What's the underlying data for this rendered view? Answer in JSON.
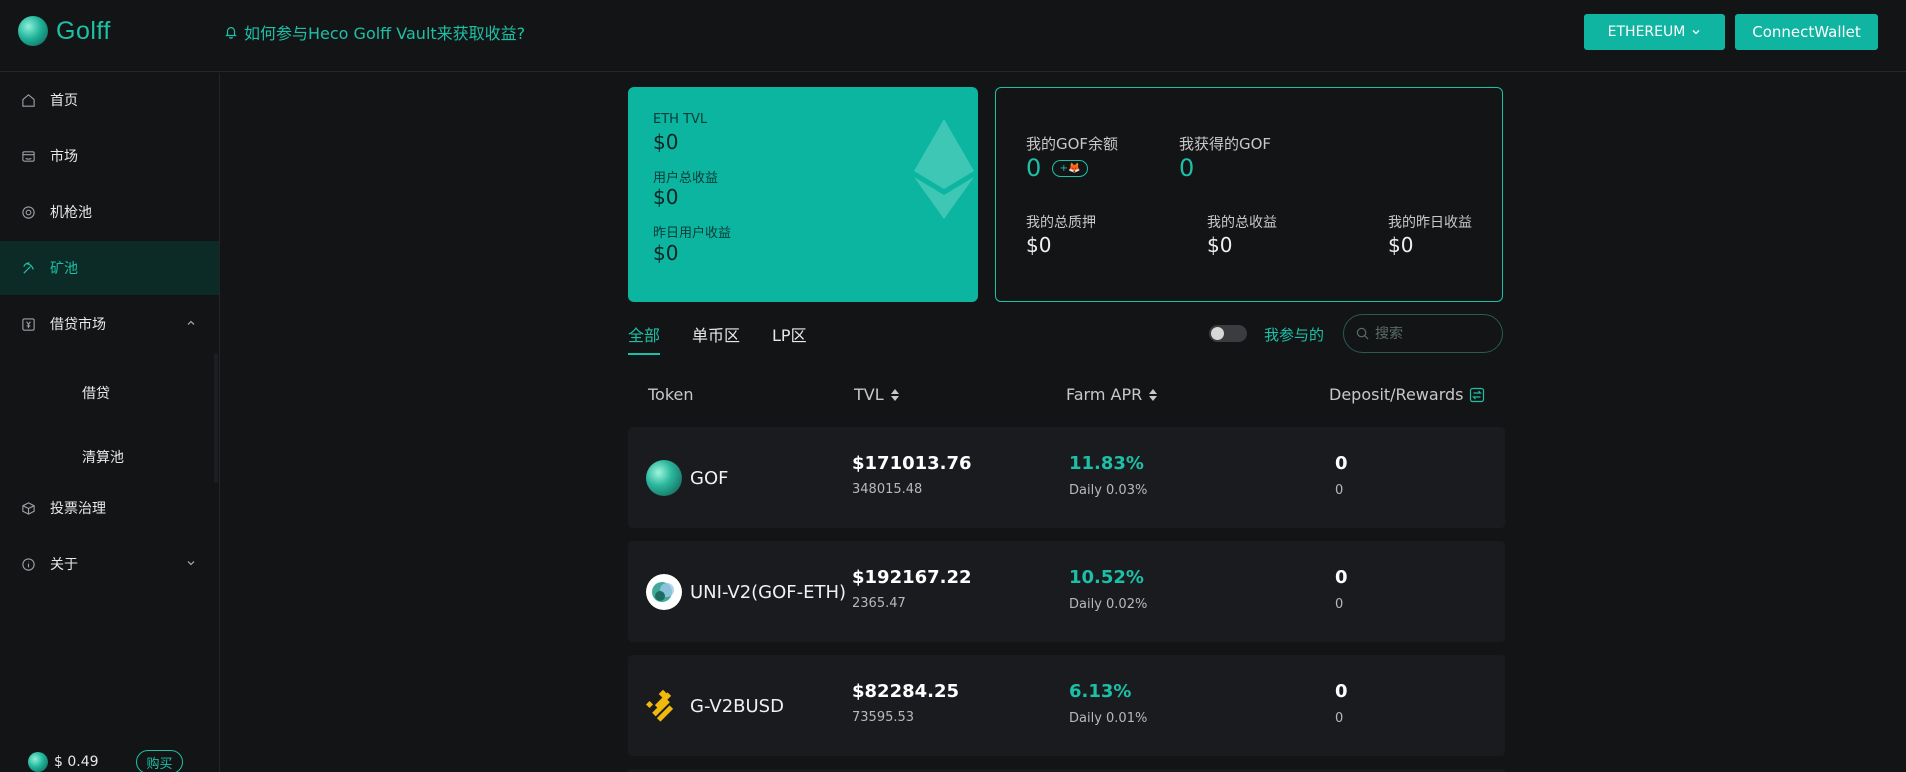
{
  "header": {
    "logo_text": "Golff",
    "announcement": "如何参与Heco Golff Vault来获取收益?",
    "network_button": "ETHEREUM",
    "connect_button": "ConnectWallet"
  },
  "sidebar": {
    "items": [
      {
        "label": "首页",
        "icon": "home-icon"
      },
      {
        "label": "市场",
        "icon": "store-icon"
      },
      {
        "label": "机枪池",
        "icon": "target-icon"
      },
      {
        "label": "矿池",
        "icon": "pickaxe-icon"
      },
      {
        "label": "借贷市场",
        "icon": "lending-icon"
      },
      {
        "label": "投票治理",
        "icon": "cube-icon"
      },
      {
        "label": "关于",
        "icon": "info-icon"
      }
    ],
    "sub_items": [
      "借贷",
      "清算池"
    ],
    "price": "$ 0.49",
    "buy_label": "购买"
  },
  "tvl_card": {
    "eth_tvl_label": "ETH TVL",
    "eth_tvl_value": "$0",
    "total_income_label": "用户总收益",
    "total_income_value": "$0",
    "yesterday_income_label": "昨日用户收益",
    "yesterday_income_value": "$0"
  },
  "my_card": {
    "gof_balance_label": "我的GOF余额",
    "gof_balance_value": "0",
    "gof_earned_label": "我获得的GOF",
    "gof_earned_value": "0",
    "total_stake_label": "我的总质押",
    "total_stake_value": "$0",
    "total_income_label": "我的总收益",
    "total_income_value": "$0",
    "yesterday_income_label": "我的昨日收益",
    "yesterday_income_value": "$0"
  },
  "tabs": [
    "全部",
    "单币区",
    "LP区"
  ],
  "filter": {
    "toggle_label": "我参与的",
    "search_placeholder": "搜索"
  },
  "table": {
    "headers": [
      "Token",
      "TVL",
      "Farm APR",
      "Deposit/Rewards"
    ],
    "rows": [
      {
        "token": "GOF",
        "tvl": "$171013.76",
        "tvl_sub": "348015.48",
        "apr": "11.83%",
        "apr_sub": "Daily 0.03%",
        "deposit": "0",
        "rewards": "0"
      },
      {
        "token": "UNI-V2(GOF-ETH)",
        "tvl": "$192167.22",
        "tvl_sub": "2365.47",
        "apr": "10.52%",
        "apr_sub": "Daily 0.02%",
        "deposit": "0",
        "rewards": "0"
      },
      {
        "token": "G-V2BUSD",
        "tvl": "$82284.25",
        "tvl_sub": "73595.53",
        "apr": "6.13%",
        "apr_sub": "Daily 0.01%",
        "deposit": "0",
        "rewards": "0"
      }
    ]
  },
  "colors": {
    "accent": "#1cc0a6",
    "card_bg": "#0bb5a0",
    "page_bg": "#131416"
  }
}
